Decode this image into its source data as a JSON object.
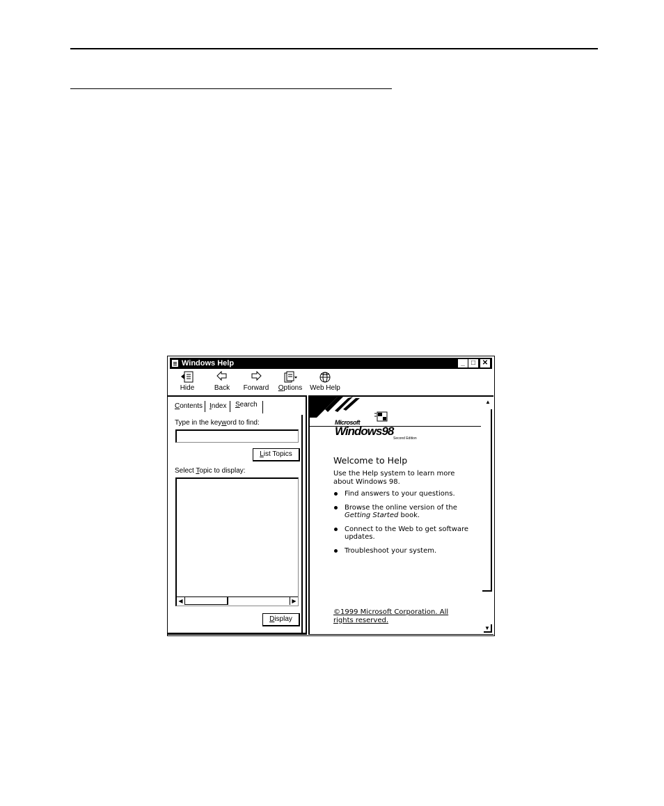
{
  "window": {
    "title": "Windows Help",
    "controls": {
      "minimize": "_",
      "maximize": "□",
      "close": "✕"
    }
  },
  "toolbar": {
    "buttons": [
      {
        "label": "Hide",
        "icon": "hide-icon",
        "accel": ""
      },
      {
        "label": "Back",
        "icon": "back-arrow-icon",
        "accel": ""
      },
      {
        "label": "Forward",
        "icon": "forward-arrow-icon",
        "accel": ""
      },
      {
        "label": "Options",
        "icon": "options-icon",
        "accel": "O"
      },
      {
        "label": "Web Help",
        "icon": "web-help-icon",
        "accel": ""
      }
    ]
  },
  "nav": {
    "tabs": [
      "Contents",
      "Index",
      "Search"
    ],
    "active_tab": "Search",
    "keyword_label": "Type in the keyword to find:",
    "keyword_value": "",
    "list_topics_button": "List Topics",
    "topic_label": "Select Topic to display:",
    "topics": [],
    "display_button": "Display"
  },
  "content": {
    "logo": {
      "microsoft": "Microsoft",
      "product": "Windows98",
      "edition": "Second Edition"
    },
    "heading": "Welcome to Help",
    "intro": "Use the Help system to learn more about Windows 98.",
    "bullets": [
      "Find answers to your questions.",
      "Browse the online version of the Getting Started book.",
      "Connect to the Web to get software updates.",
      "Troubleshoot your system."
    ],
    "copyright": "©1999 Microsoft Corporation. All rights reserved."
  }
}
